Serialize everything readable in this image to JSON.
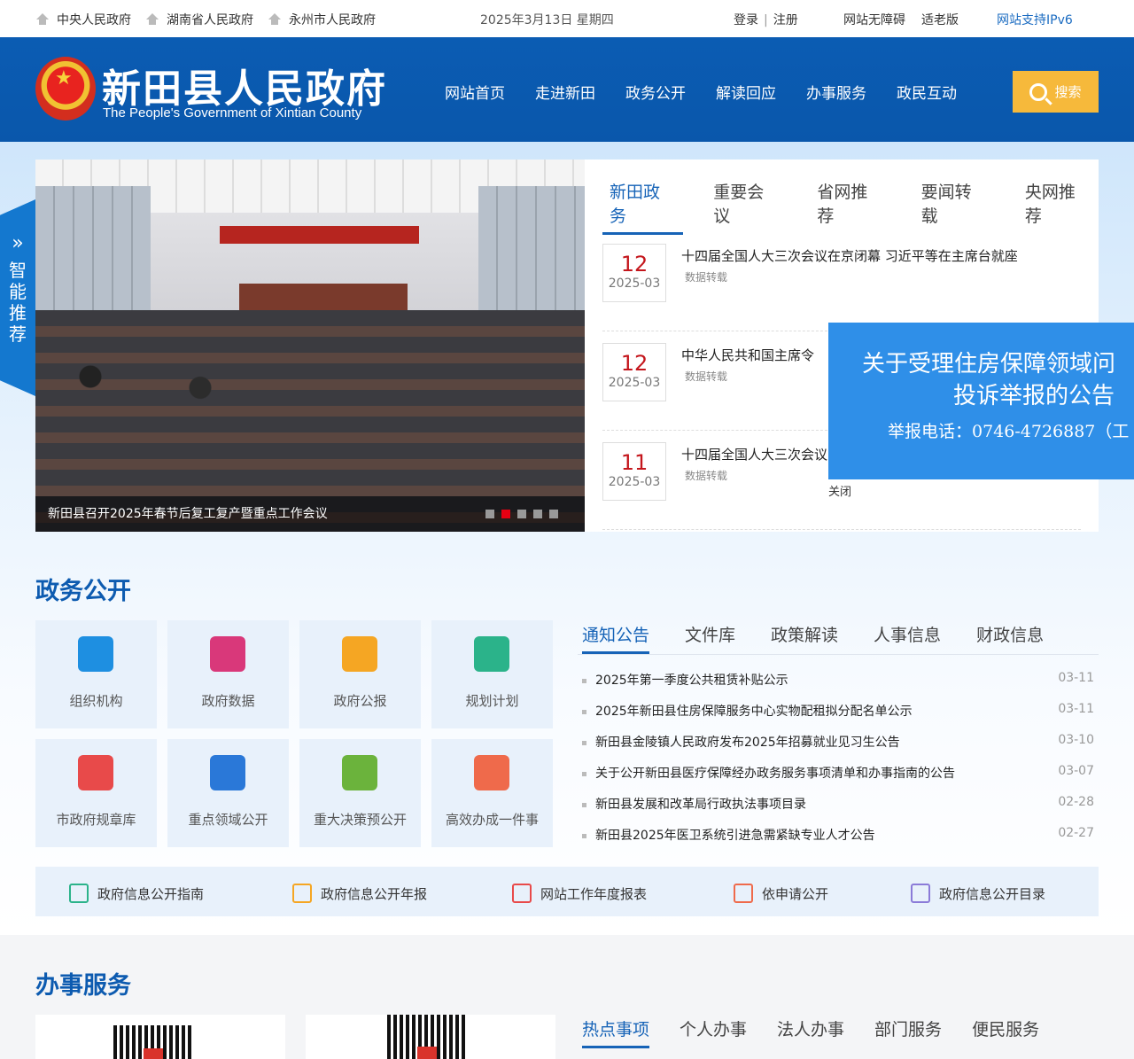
{
  "topbar": {
    "links": [
      "中央人民政府",
      "湖南省人民政府",
      "永州市人民政府"
    ],
    "date": "2025年3月13日 星期四",
    "login": "登录",
    "sep": "|",
    "register": "注册",
    "accessible": "网站无障碍",
    "elder": "适老版",
    "ipv6": "网站支持IPv6"
  },
  "header": {
    "title": "新田县人民政府",
    "subtitle": "The People's Government of Xintian County",
    "nav": [
      "网站首页",
      "走进新田",
      "政务公开",
      "解读回应",
      "办事服务",
      "政民互动"
    ],
    "search_label": "搜索"
  },
  "side_tab": {
    "chevron": "»",
    "chars": [
      "智",
      "能",
      "推",
      "荐"
    ]
  },
  "slider": {
    "caption": "新田县召开2025年春节后复工复产暨重点工作会议",
    "dot_count": 5,
    "active_dot": 2
  },
  "news": {
    "tabs": [
      "新田政务",
      "重要会议",
      "省网推荐",
      "要闻转载",
      "央网推荐"
    ],
    "active_tab": 0,
    "items": [
      {
        "day": "12",
        "month": "2025-03",
        "title": "十四届全国人大三次会议在京闭幕 习近平等在主席台就座",
        "source": "数据转载"
      },
      {
        "day": "12",
        "month": "2025-03",
        "title": "中华人民共和国主席令",
        "source": "数据转载"
      },
      {
        "day": "11",
        "month": "2025-03",
        "title": "十四届全国人大三次会议",
        "source": "数据转载"
      }
    ]
  },
  "popup": {
    "line1": "关于受理住房保障领域问",
    "line2": "投诉举报的公告",
    "line3": "举报电话：0746-4726887（工",
    "close": "关闭"
  },
  "gov": {
    "title": "政务公开",
    "tiles": [
      {
        "label": "组织机构",
        "icon": "person-icon",
        "color": "#1e8fe1"
      },
      {
        "label": "政府数据",
        "icon": "chart-icon",
        "color": "#d9387a"
      },
      {
        "label": "政府公报",
        "icon": "book-icon",
        "color": "#f5a623"
      },
      {
        "label": "规划计划",
        "icon": "stack-icon",
        "color": "#2bb38a"
      },
      {
        "label": "市政府规章库",
        "icon": "star-book-icon",
        "color": "#e84a4a"
      },
      {
        "label": "重点领域公开",
        "icon": "list-icon",
        "color": "#2a78d8"
      },
      {
        "label": "重大决策预公开",
        "icon": "doc-icon",
        "color": "#6bb33c"
      },
      {
        "label": "高效办成一件事",
        "icon": "file-icon",
        "color": "#ef6a4b"
      }
    ],
    "tabs": [
      "通知公告",
      "文件库",
      "政策解读",
      "人事信息",
      "财政信息"
    ],
    "active_tab": 0,
    "notices": [
      {
        "title": "2025年第一季度公共租赁补贴公示",
        "date": "03-11"
      },
      {
        "title": "2025年新田县住房保障服务中心实物配租拟分配名单公示",
        "date": "03-11"
      },
      {
        "title": "新田县金陵镇人民政府发布2025年招募就业见习生公告",
        "date": "03-10"
      },
      {
        "title": "关于公开新田县医疗保障经办政务服务事项清单和办事指南的公告",
        "date": "03-07"
      },
      {
        "title": "新田县发展和改革局行政执法事项目录",
        "date": "02-28"
      },
      {
        "title": "新田县2025年医卫系统引进急需紧缺专业人才公告",
        "date": "02-27"
      }
    ],
    "quicklinks": [
      {
        "label": "政府信息公开指南",
        "icon": "guide-icon",
        "color": "#2bb38a"
      },
      {
        "label": "政府信息公开年报",
        "icon": "report-icon",
        "color": "#f5a623"
      },
      {
        "label": "网站工作年度报表",
        "icon": "table-icon",
        "color": "#e84a4a"
      },
      {
        "label": "依申请公开",
        "icon": "grid-icon",
        "color": "#ef6a4b"
      },
      {
        "label": "政府信息公开目录",
        "icon": "catalog-icon",
        "color": "#8b7bd8"
      }
    ]
  },
  "service": {
    "title": "办事服务",
    "tabs": [
      "热点事项",
      "个人办事",
      "法人办事",
      "部门服务",
      "便民服务"
    ],
    "active_tab": 0
  }
}
